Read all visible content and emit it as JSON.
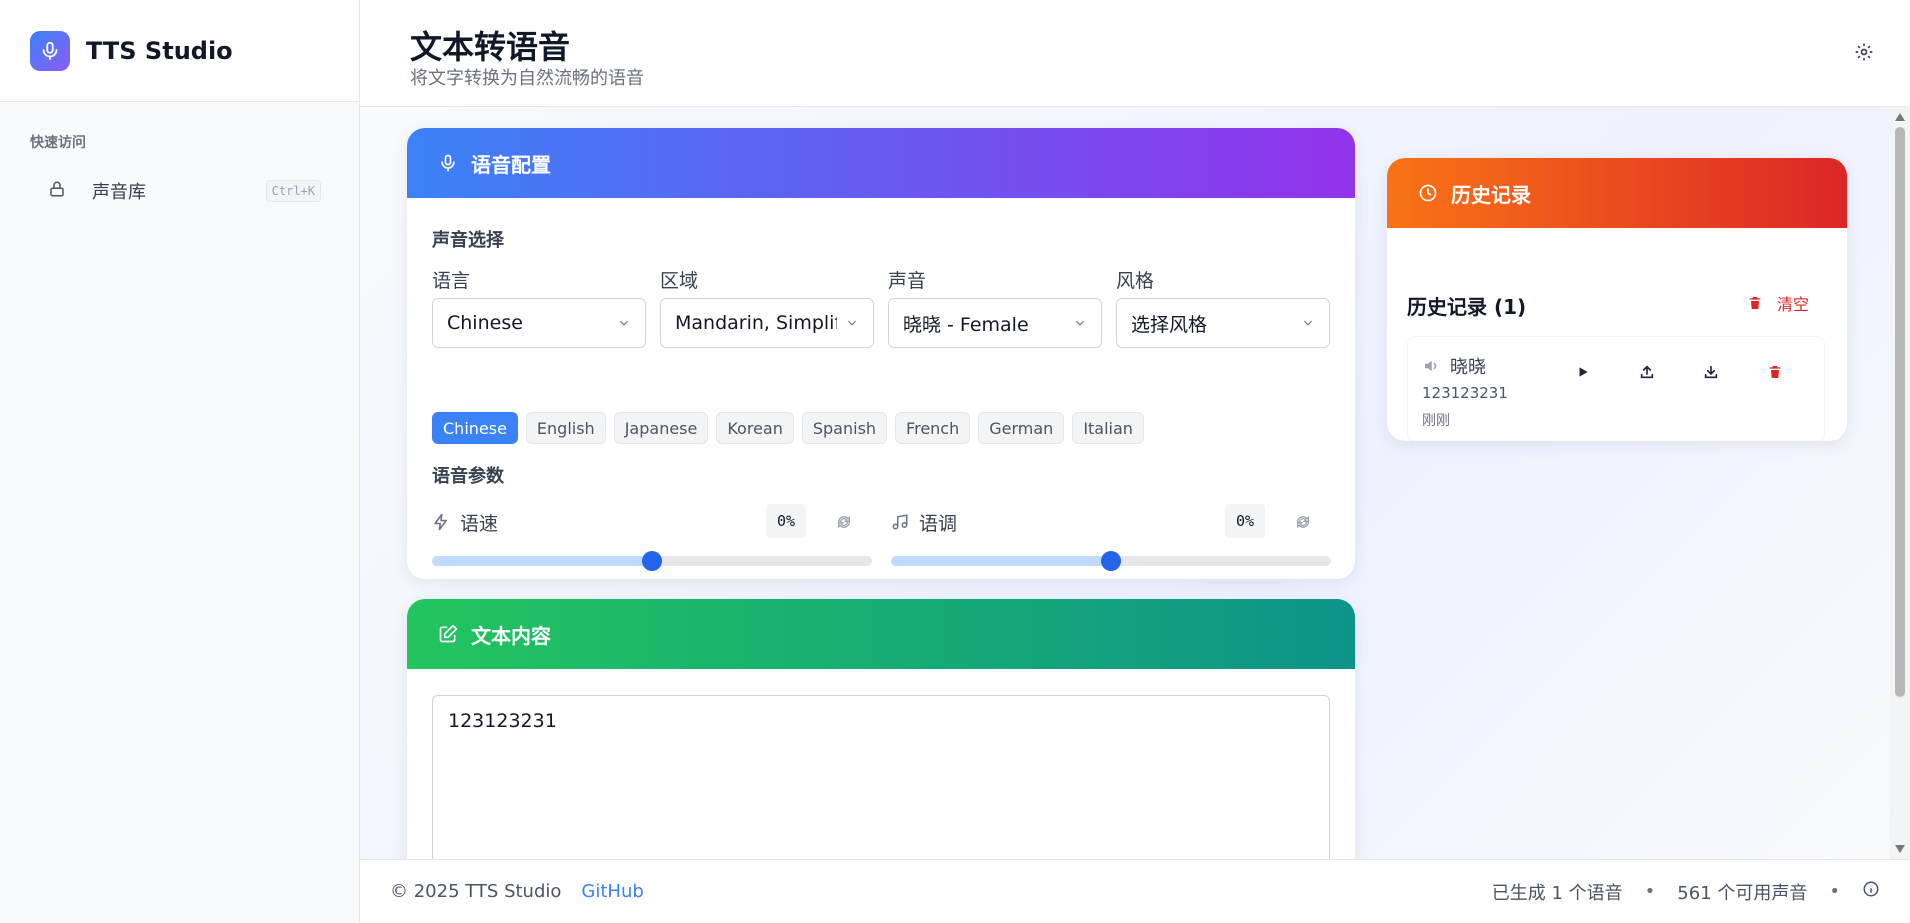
{
  "brand": {
    "name": "TTS Studio",
    "icon": "microphone-icon"
  },
  "sidebar": {
    "section_title": "快速访问",
    "items": [
      {
        "label": "声音库",
        "shortcut": "Ctrl+K",
        "icon": "lock-icon"
      }
    ]
  },
  "header": {
    "title": "文本转语音",
    "subtitle": "将文字转换为自然流畅的语音",
    "settings_icon": "gear-icon"
  },
  "voice_config": {
    "title": "语音配置",
    "selection_title": "声音选择",
    "fields": [
      {
        "label": "语言",
        "value": "Chinese"
      },
      {
        "label": "区域",
        "value": "Mandarin, Simplified"
      },
      {
        "label": "声音",
        "value": "晓晓 - Female"
      },
      {
        "label": "风格",
        "value": "选择风格"
      }
    ],
    "language_tags": [
      "Chinese",
      "English",
      "Japanese",
      "Korean",
      "Spanish",
      "French",
      "German",
      "Italian"
    ],
    "active_tag": "Chinese",
    "params_title": "语音参数",
    "rate": {
      "label": "语速",
      "value": "0%",
      "level": 0.5
    },
    "pitch": {
      "label": "语调",
      "value": "0%",
      "level": 0.5
    }
  },
  "text_content": {
    "title": "文本内容",
    "value": "123123231"
  },
  "history": {
    "header": "历史记录",
    "title": "历史记录 (1)",
    "clear_label": "清空",
    "items": [
      {
        "voice": "晓晓",
        "text": "123123231",
        "time": "刚刚"
      }
    ]
  },
  "footer": {
    "copyright": "© 2025 TTS Studio",
    "github": "GitHub",
    "generated": "已生成 1 个语音",
    "dot": "•",
    "available": "561 个可用声音"
  },
  "colors": {
    "voice_header_gradient": [
      "#3b82f6",
      "#9333ea"
    ],
    "text_header_gradient": [
      "#22c55e",
      "#0d9488"
    ],
    "history_header_gradient": [
      "#f97316",
      "#dc2626"
    ],
    "accent": "#3b82f6",
    "danger": "#dc2626"
  }
}
